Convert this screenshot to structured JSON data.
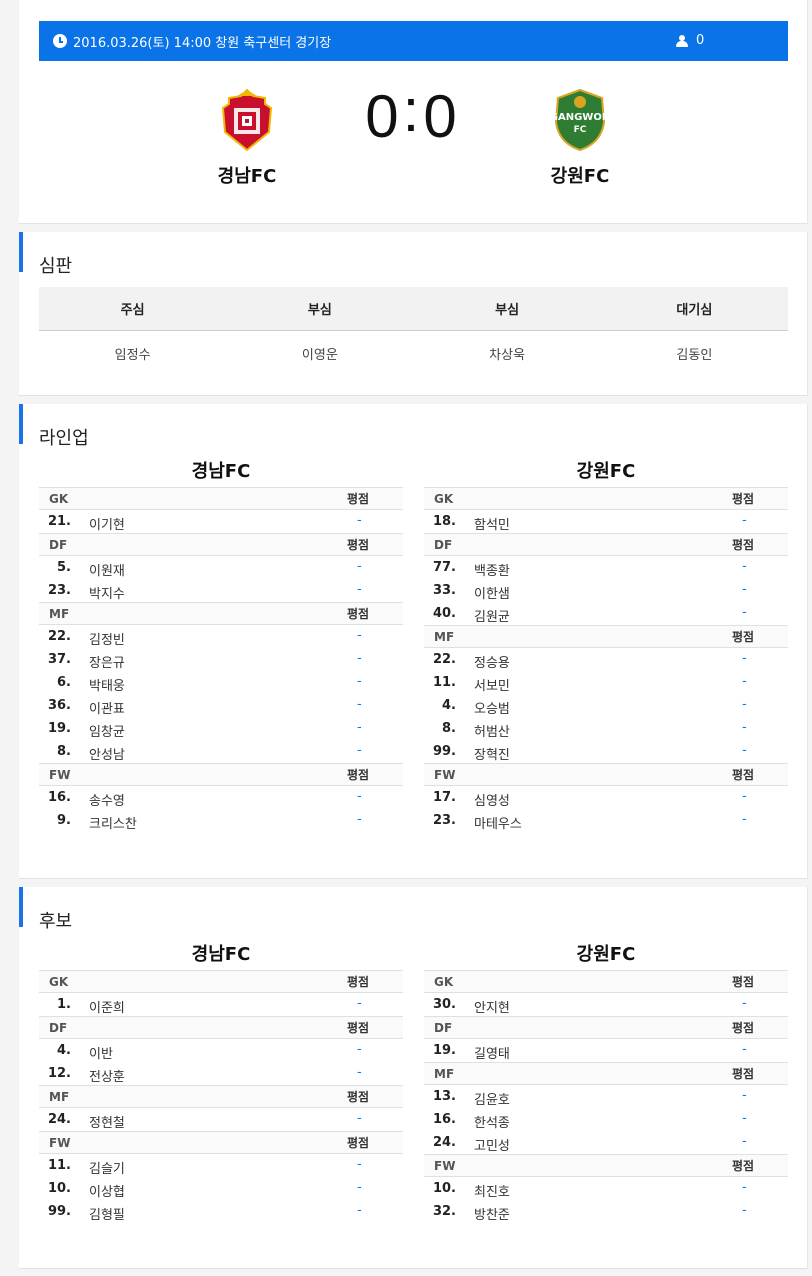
{
  "match": {
    "info": "2016.03.26(토) 14:00 창원 축구센터 경기장",
    "attendance": "0",
    "home": {
      "name": "경남FC",
      "logo_text": "",
      "color": "#c8102e"
    },
    "away": {
      "name": "강원FC",
      "logo_text": "GANGWON",
      "logo_sub": "FC",
      "color": "#2e7d32"
    },
    "score_home": "0",
    "score_away": "0",
    "score_sep": ":"
  },
  "referee": {
    "title": "심판",
    "headers": [
      "주심",
      "부심",
      "부심",
      "대기심"
    ],
    "names": [
      "임정수",
      "이영운",
      "차상욱",
      "김동인"
    ]
  },
  "lineup": {
    "title": "라인업",
    "rating_label": "평점",
    "home": {
      "team": "경남FC",
      "groups": [
        {
          "pos": "GK",
          "players": [
            {
              "num": "21.",
              "name": "이기현",
              "rating": "-"
            }
          ]
        },
        {
          "pos": "DF",
          "players": [
            {
              "num": "5.",
              "name": "이원재",
              "rating": "-"
            },
            {
              "num": "23.",
              "name": "박지수",
              "rating": "-"
            }
          ]
        },
        {
          "pos": "MF",
          "players": [
            {
              "num": "22.",
              "name": "김정빈",
              "rating": "-"
            },
            {
              "num": "37.",
              "name": "장은규",
              "rating": "-"
            },
            {
              "num": "6.",
              "name": "박태웅",
              "rating": "-"
            },
            {
              "num": "36.",
              "name": "이관표",
              "rating": "-"
            },
            {
              "num": "19.",
              "name": "임창균",
              "rating": "-"
            },
            {
              "num": "8.",
              "name": "안성남",
              "rating": "-"
            }
          ]
        },
        {
          "pos": "FW",
          "players": [
            {
              "num": "16.",
              "name": "송수영",
              "rating": "-"
            },
            {
              "num": "9.",
              "name": "크리스찬",
              "rating": "-"
            }
          ]
        }
      ]
    },
    "away": {
      "team": "강원FC",
      "groups": [
        {
          "pos": "GK",
          "players": [
            {
              "num": "18.",
              "name": "함석민",
              "rating": "-"
            }
          ]
        },
        {
          "pos": "DF",
          "players": [
            {
              "num": "77.",
              "name": "백종환",
              "rating": "-"
            },
            {
              "num": "33.",
              "name": "이한샘",
              "rating": "-"
            },
            {
              "num": "40.",
              "name": "김원균",
              "rating": "-"
            }
          ]
        },
        {
          "pos": "MF",
          "players": [
            {
              "num": "22.",
              "name": "정승용",
              "rating": "-"
            },
            {
              "num": "11.",
              "name": "서보민",
              "rating": "-"
            },
            {
              "num": "4.",
              "name": "오승범",
              "rating": "-"
            },
            {
              "num": "8.",
              "name": "허범산",
              "rating": "-"
            },
            {
              "num": "99.",
              "name": "장혁진",
              "rating": "-"
            }
          ]
        },
        {
          "pos": "FW",
          "players": [
            {
              "num": "17.",
              "name": "심영성",
              "rating": "-"
            },
            {
              "num": "23.",
              "name": "마테우스",
              "rating": "-"
            }
          ]
        }
      ]
    }
  },
  "subs": {
    "title": "후보",
    "rating_label": "평점",
    "home": {
      "team": "경남FC",
      "groups": [
        {
          "pos": "GK",
          "players": [
            {
              "num": "1.",
              "name": "이준희",
              "rating": "-"
            }
          ]
        },
        {
          "pos": "DF",
          "players": [
            {
              "num": "4.",
              "name": "이반",
              "rating": "-"
            },
            {
              "num": "12.",
              "name": "전상훈",
              "rating": "-"
            }
          ]
        },
        {
          "pos": "MF",
          "players": [
            {
              "num": "24.",
              "name": "정현철",
              "rating": "-"
            }
          ]
        },
        {
          "pos": "FW",
          "players": [
            {
              "num": "11.",
              "name": "김슬기",
              "rating": "-"
            },
            {
              "num": "10.",
              "name": "이상협",
              "rating": "-"
            },
            {
              "num": "99.",
              "name": "김형필",
              "rating": "-"
            }
          ]
        }
      ]
    },
    "away": {
      "team": "강원FC",
      "groups": [
        {
          "pos": "GK",
          "players": [
            {
              "num": "30.",
              "name": "안지현",
              "rating": "-"
            }
          ]
        },
        {
          "pos": "DF",
          "players": [
            {
              "num": "19.",
              "name": "길영태",
              "rating": "-"
            }
          ]
        },
        {
          "pos": "MF",
          "players": [
            {
              "num": "13.",
              "name": "김윤호",
              "rating": "-"
            },
            {
              "num": "16.",
              "name": "한석종",
              "rating": "-"
            },
            {
              "num": "24.",
              "name": "고민성",
              "rating": "-"
            }
          ]
        },
        {
          "pos": "FW",
          "players": [
            {
              "num": "10.",
              "name": "최진호",
              "rating": "-"
            },
            {
              "num": "32.",
              "name": "방찬준",
              "rating": "-"
            }
          ]
        }
      ]
    }
  }
}
